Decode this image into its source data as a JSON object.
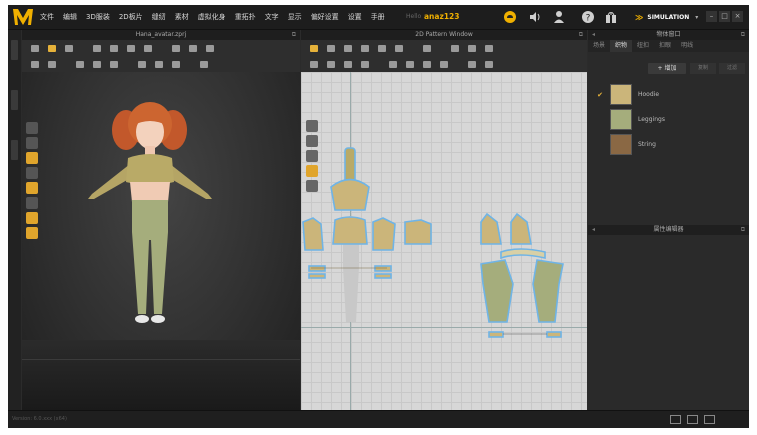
{
  "app": {
    "logo": "MD",
    "menus": [
      "文件",
      "编辑",
      "3D服装",
      "2D板片",
      "缝纫",
      "素材",
      "虚拟化身",
      "重拓扑",
      "文字",
      "显示",
      "偏好设置",
      "设置",
      "手册"
    ],
    "user_prefix": "Hello",
    "user": "anaz123",
    "simulation": "SIMULATION",
    "window_buttons": [
      "–",
      "□",
      "×"
    ]
  },
  "panel3d": {
    "title": "Hana_avatar.zprj"
  },
  "panel2d": {
    "title": "2D Pattern Window"
  },
  "object_panel": {
    "title": "物体窗口",
    "tabs": [
      "场景",
      "织物",
      "纽扣",
      "扣眼",
      "明线"
    ],
    "active_tab": 1,
    "add_button": "+ 增加",
    "extra_buttons": [
      "复制",
      "过滤"
    ],
    "fabrics": [
      {
        "name": "Hoodie",
        "checked": true,
        "color": "#cbb57a"
      },
      {
        "name": "Leggings",
        "checked": false,
        "color": "#a5ad7c"
      },
      {
        "name": "String",
        "checked": false,
        "color": "#8a6844"
      }
    ]
  },
  "property_editor": {
    "title": "属性编辑器"
  },
  "status": {
    "version": "Version: 6.0.xxx (x64)"
  },
  "icons": [
    "logo-icon",
    "cloud-icon",
    "speaker-icon",
    "person-icon",
    "help-icon",
    "gift-icon",
    "chevron-icon"
  ],
  "colors": {
    "accent": "#f0b000",
    "hoodie": "#cbb57a",
    "leggings": "#a5ad7c",
    "outline": "#6fb4e6"
  }
}
